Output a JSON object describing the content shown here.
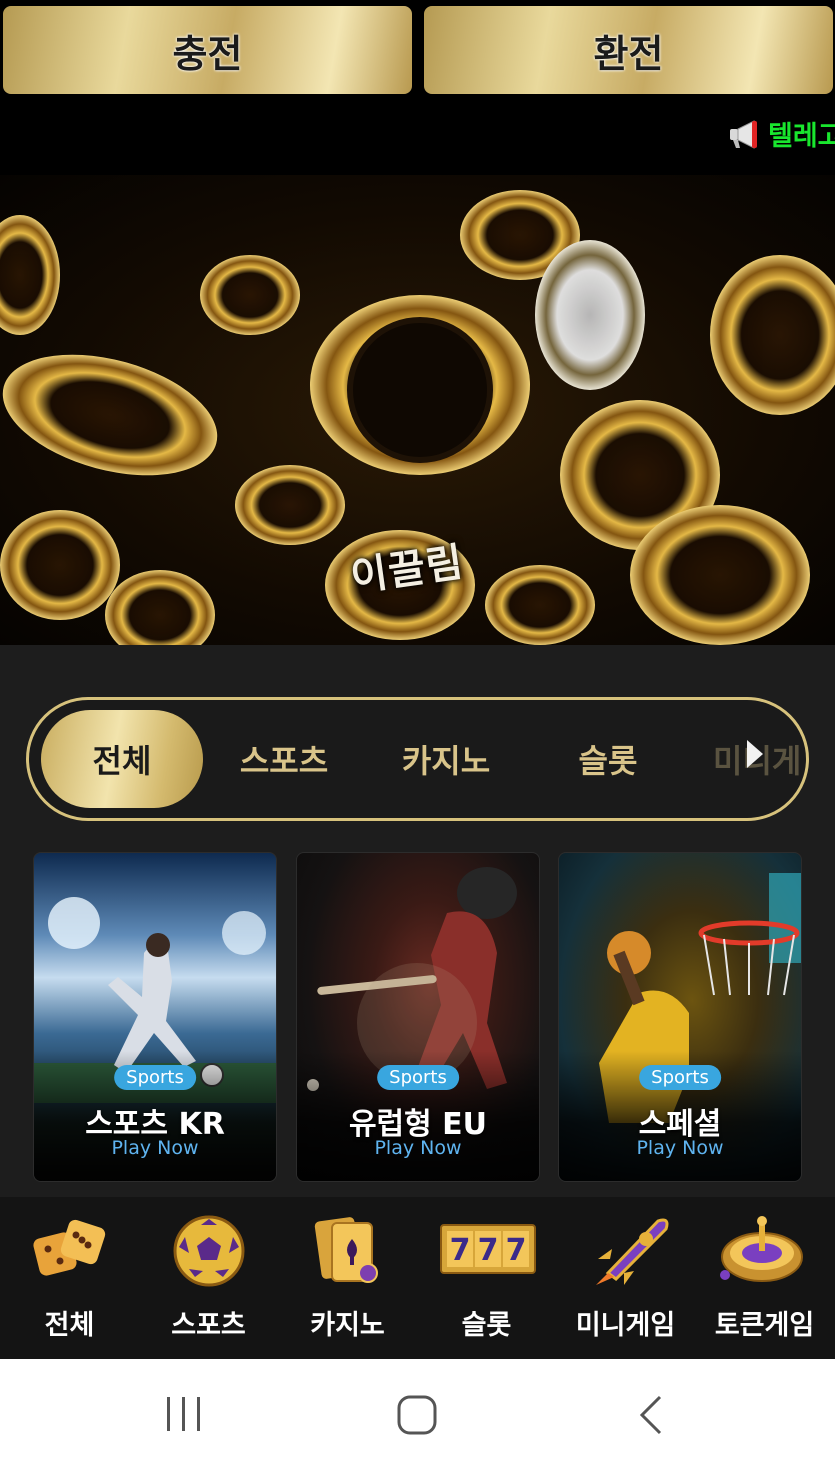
{
  "top_buttons": {
    "charge_label": "충전",
    "exchange_label": "환전"
  },
  "marquee": {
    "icon": "megaphone-icon",
    "text": "텔레고",
    "color": "#19e62e"
  },
  "banner": {
    "logo_text": "이끌림"
  },
  "tabs": [
    {
      "label": "전체",
      "active": true
    },
    {
      "label": "스포츠",
      "active": false
    },
    {
      "label": "카지노",
      "active": false
    },
    {
      "label": "슬롯",
      "active": false
    },
    {
      "label": "미니게",
      "active": false
    }
  ],
  "cards": [
    {
      "badge": "Sports",
      "title": "스포츠 KR",
      "cta": "Play Now"
    },
    {
      "badge": "Sports",
      "title": "유럽형 EU",
      "cta": "Play Now"
    },
    {
      "badge": "Sports",
      "title": "스페셜",
      "cta": "Play Now"
    }
  ],
  "bottom_nav": [
    {
      "label": "전체",
      "icon": "dice-icon"
    },
    {
      "label": "스포츠",
      "icon": "soccer-ball-icon"
    },
    {
      "label": "카지노",
      "icon": "playing-cards-icon"
    },
    {
      "label": "슬롯",
      "icon": "slot-777-icon"
    },
    {
      "label": "미니게임",
      "icon": "rocket-icon"
    },
    {
      "label": "토큰게임",
      "icon": "roulette-icon"
    }
  ],
  "colors": {
    "gold": "#d7c27c",
    "badge_blue": "#39a6df",
    "play_now_blue": "#5fb4f0"
  }
}
